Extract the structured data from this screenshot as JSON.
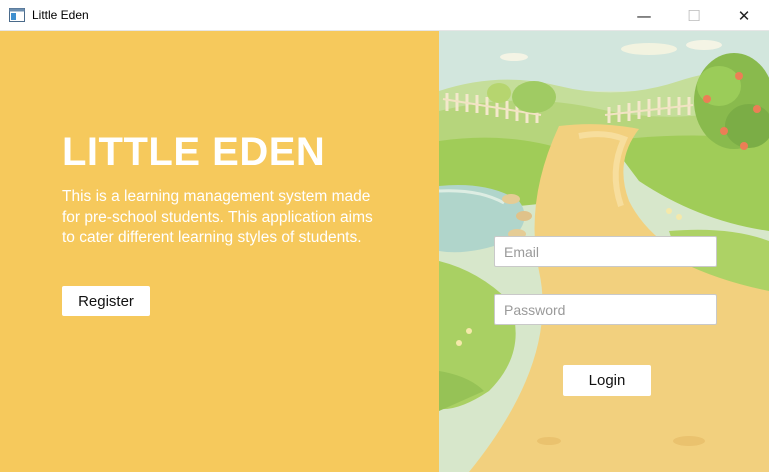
{
  "window": {
    "title": "Little Eden",
    "controls": {
      "minimize": "—",
      "maximize": "☐",
      "close": "✕"
    },
    "app_icon": "window-app-icon"
  },
  "left_panel": {
    "background": "#f6c95c",
    "heading": "LITTLE EDEN",
    "description": "This is a learning management system made for pre-school students. This application aims to cater different learning styles of students.",
    "register_label": "Register"
  },
  "login_form": {
    "email_placeholder": "Email",
    "email_value": "",
    "password_placeholder": "Password",
    "password_value": "",
    "login_label": "Login"
  }
}
